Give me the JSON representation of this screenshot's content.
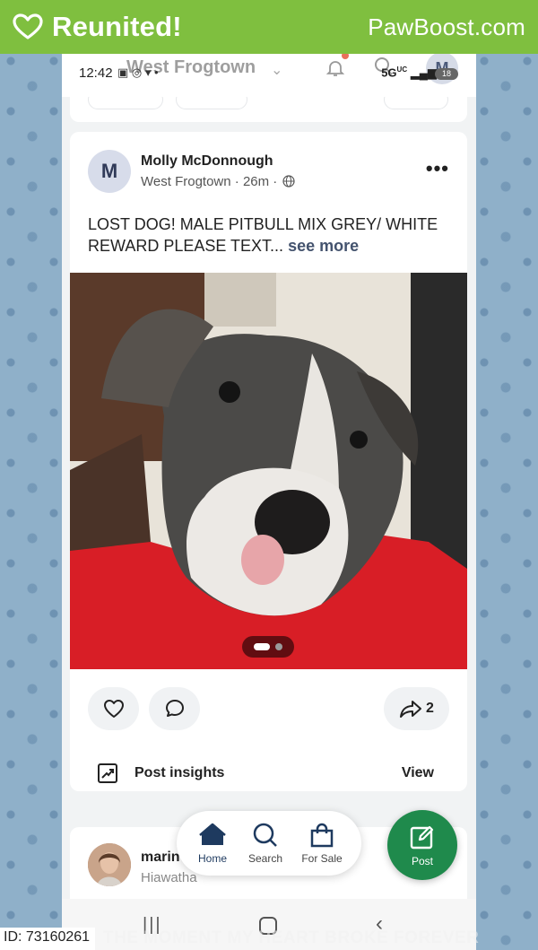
{
  "banner": {
    "title": "Reunited!",
    "brand": "PawBoost.com"
  },
  "status_bar": {
    "time": "12:42",
    "icons_text": "▣ ◎ ▾ •",
    "network": "5G",
    "network_sub": "UC",
    "battery": "18"
  },
  "top_nav": {
    "location": "West Frogtown",
    "avatar_letter": "M"
  },
  "post": {
    "author_initial": "M",
    "author_name": "Molly McDonnough",
    "neighborhood": "West Frogtown",
    "time_ago": "26m",
    "text": "LOST DOG! MALE PITBULL MIX GREY/ WHITE REWARD PLEASE TEXT...",
    "see_more": "see more",
    "share_count": "2",
    "insights_label": "Post insights",
    "insights_view": "View"
  },
  "next_post": {
    "author_name": "marin",
    "neighborhood": "Hiawatha"
  },
  "bottom_nav": {
    "items": [
      {
        "label": "Home",
        "icon": "home-icon",
        "active": true
      },
      {
        "label": "Search",
        "icon": "search-icon",
        "active": false
      },
      {
        "label": "For Sale",
        "icon": "shopping-bag-icon",
        "active": false
      }
    ],
    "post_label": "Post"
  },
  "footer": {
    "id_label": "ID: 73160261",
    "caption": "THE MOMENT MY HEART BROKE FOREVER"
  },
  "colors": {
    "banner_green": "#7fbf3f",
    "fab_green": "#1f8a4c",
    "side_blue": "#8fb0c9"
  }
}
